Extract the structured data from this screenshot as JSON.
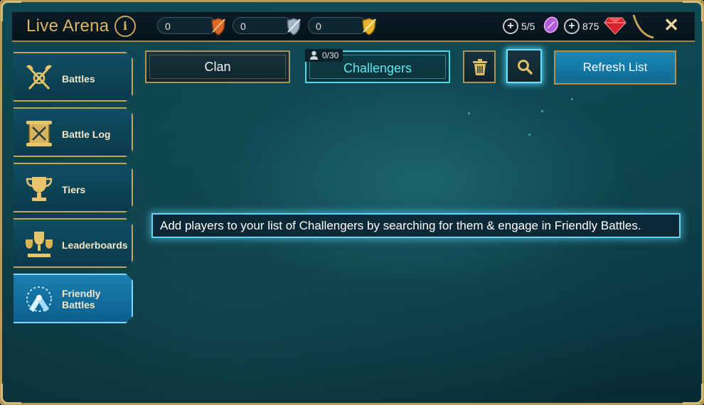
{
  "header": {
    "title": "Live Arena",
    "info_glyph": "i",
    "counters": [
      {
        "value": "0",
        "icon": "bronze-shield-icon",
        "color": "#e0743a"
      },
      {
        "value": "0",
        "icon": "silver-shield-icon",
        "color": "#a9c0cc"
      },
      {
        "value": "0",
        "icon": "gold-shield-icon",
        "color": "#e8b531"
      }
    ],
    "tokens": {
      "plus": "+",
      "value": "5/5",
      "icon": "purple-token-icon"
    },
    "gems": {
      "plus": "+",
      "value": "875",
      "icon": "ruby-gem-icon"
    },
    "close_glyph": "✕"
  },
  "sidebar": {
    "items": [
      {
        "label": "Battles",
        "icon": "crossed-axes-icon"
      },
      {
        "label": "Battle Log",
        "icon": "scroll-swords-icon"
      },
      {
        "label": "Tiers",
        "icon": "trophy-icon"
      },
      {
        "label": "Leaderboards",
        "icon": "trophies-icon"
      },
      {
        "label_line1": "Friendly",
        "label_line2": "Battles",
        "icon": "handshake-icon",
        "active": true
      }
    ]
  },
  "toolbar": {
    "clan_tab": "Clan",
    "challengers_tab": "Challengers",
    "challengers_count": "0/30",
    "refresh_label": "Refresh List"
  },
  "main": {
    "message": "Add players to your list of Challengers by searching for them & engage in Friendly Battles."
  },
  "colors": {
    "gold": "#c4a35a",
    "accent_cyan": "#5de6f0",
    "active_blue": "#1a7fb0"
  }
}
